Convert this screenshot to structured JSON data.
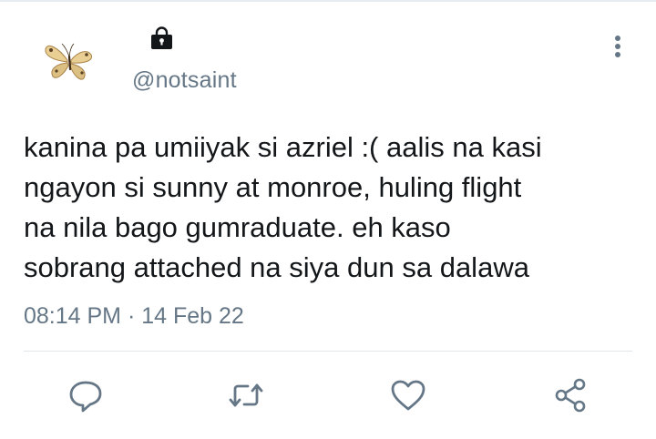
{
  "tweet": {
    "handle": "@notsaint",
    "text_lines": [
      "kanina pa umiiyak si azriel :( aalis na kasi",
      "ngayon si sunny at monroe, huling flight",
      "na nila bago gumraduate. eh kaso",
      "sobrang attached na siya dun sa dalawa"
    ],
    "time": "08:14 PM",
    "separator": "·",
    "date": "14 Feb 22"
  },
  "icons": {
    "avatar": "butterfly-avatar",
    "locked": "lock-icon",
    "menu": "more-vertical-icon",
    "reply": "reply-icon",
    "retweet": "retweet-icon",
    "like": "heart-icon",
    "share": "share-icon"
  },
  "colors": {
    "text": "#14171a",
    "secondary": "#657786",
    "icon": "#657786",
    "divider": "#e1e8ed"
  }
}
